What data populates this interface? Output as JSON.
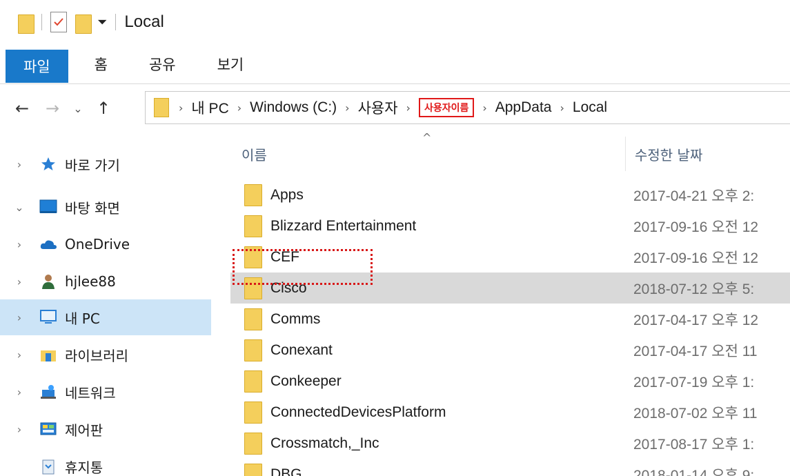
{
  "window": {
    "title": "Local"
  },
  "quick_access": {
    "dropdown_glyph": "⏷"
  },
  "ribbon": {
    "tabs": [
      {
        "label": "파일",
        "active": true
      },
      {
        "label": "홈",
        "active": false
      },
      {
        "label": "공유",
        "active": false
      },
      {
        "label": "보기",
        "active": false
      }
    ]
  },
  "address_bar": {
    "crumbs": [
      "내 PC",
      "Windows (C:)",
      "사용자",
      "사용자이름",
      "AppData",
      "Local"
    ],
    "separator": "›"
  },
  "nav_pane": {
    "items": [
      {
        "label": "바로 가기",
        "icon": "star-icon",
        "expanded": false,
        "selected": false
      },
      {
        "label": "바탕 화면",
        "icon": "desktop-icon",
        "expanded": true,
        "selected": false
      },
      {
        "label": "OneDrive",
        "icon": "cloud-icon",
        "expanded": false,
        "selected": false
      },
      {
        "label": "hjlee88",
        "icon": "user-icon",
        "expanded": false,
        "selected": false
      },
      {
        "label": "내 PC",
        "icon": "computer-icon",
        "expanded": false,
        "selected": true
      },
      {
        "label": "라이브러리",
        "icon": "library-icon",
        "expanded": false,
        "selected": false
      },
      {
        "label": "네트워크",
        "icon": "network-icon",
        "expanded": false,
        "selected": false
      },
      {
        "label": "제어판",
        "icon": "control-panel-icon",
        "expanded": false,
        "selected": false
      },
      {
        "label": "휴지통",
        "icon": "recycle-bin-icon",
        "expanded": false,
        "selected": false
      }
    ]
  },
  "columns": {
    "name": "이름",
    "date_modified": "수정한 날짜"
  },
  "files": [
    {
      "name": "Apps",
      "date": "2017-04-21 오후 2:"
    },
    {
      "name": "Blizzard Entertainment",
      "date": "2017-09-16 오전 12"
    },
    {
      "name": "CEF",
      "date": "2017-09-16 오전 12"
    },
    {
      "name": "Cisco",
      "date": "2018-07-12 오후 5:",
      "selected": true
    },
    {
      "name": "Comms",
      "date": "2017-04-17 오후 12"
    },
    {
      "name": "Conexant",
      "date": "2017-04-17 오전 11"
    },
    {
      "name": "Conkeeper",
      "date": "2017-07-19 오후 1:"
    },
    {
      "name": "ConnectedDevicesPlatform",
      "date": "2018-07-02 오후 11"
    },
    {
      "name": "Crossmatch,_Inc",
      "date": "2017-08-17 오후 1:"
    },
    {
      "name": "DBG",
      "date": "2018-01-14 오후 9:"
    }
  ],
  "colors": {
    "accent": "#1979ca",
    "selected_nav": "#cce4f7",
    "selected_row": "#d9d9d9",
    "folder": "#f4cf5c",
    "annotation_red": "#e01818"
  }
}
